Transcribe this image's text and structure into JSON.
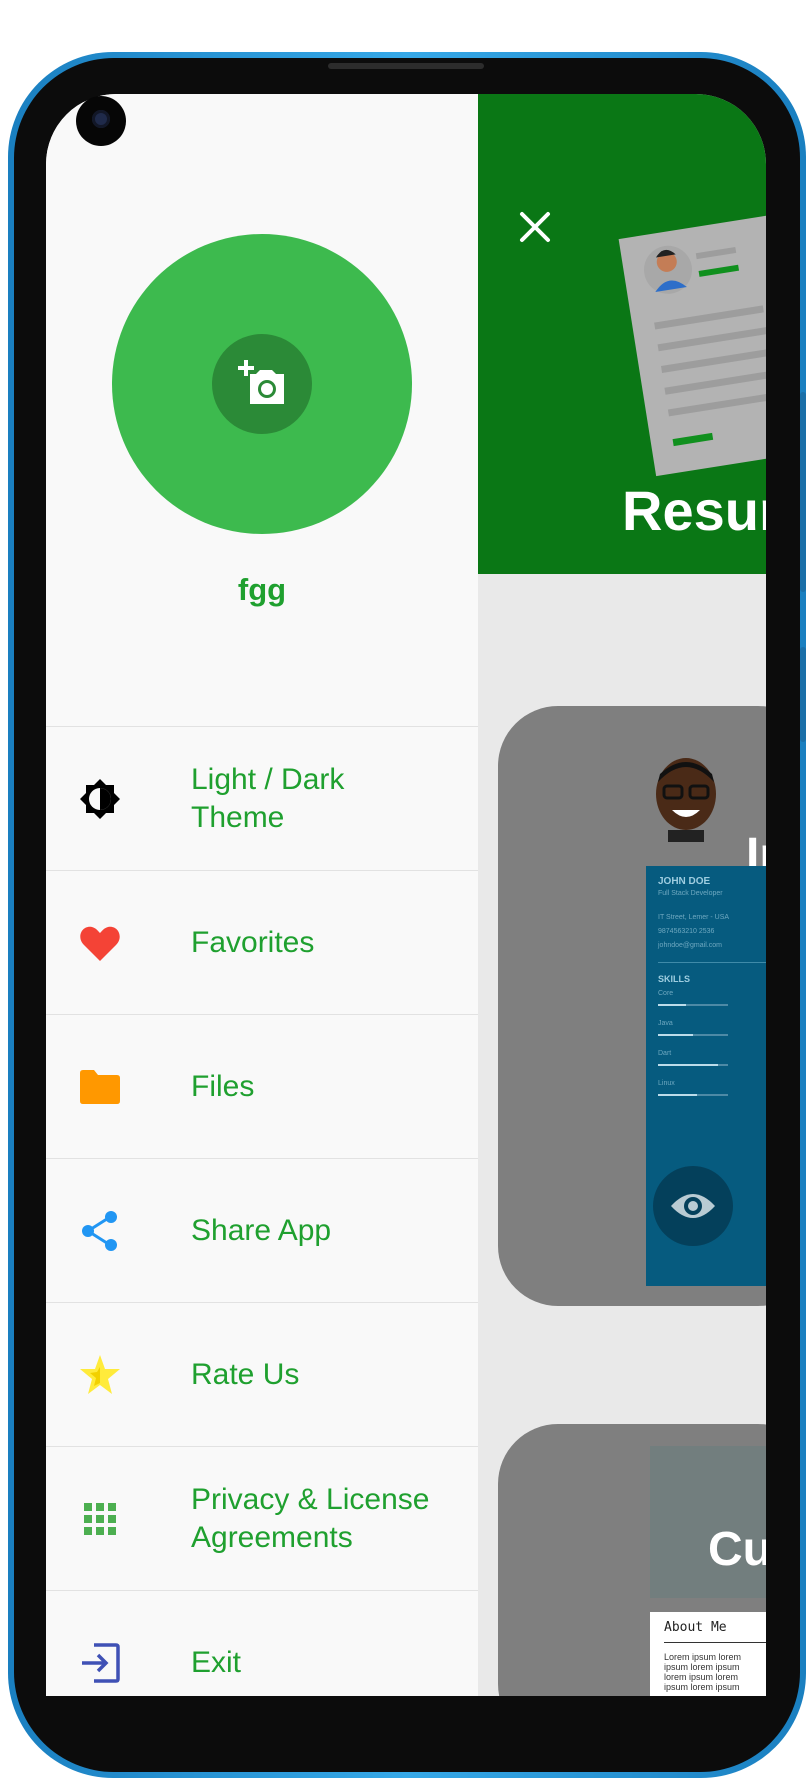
{
  "drawer": {
    "user_name": "fgg",
    "avatar_icon": "add-a-photo-icon",
    "menu": [
      {
        "label": "Light / Dark Theme",
        "icon": "brightness-icon",
        "color": "#000000"
      },
      {
        "label": "Favorites",
        "icon": "heart-icon",
        "color": "#f44336"
      },
      {
        "label": "Files",
        "icon": "folder-icon",
        "color": "#ff9800"
      },
      {
        "label": "Share App",
        "icon": "share-icon",
        "color": "#2196f3"
      },
      {
        "label": "Rate Us",
        "icon": "star-icon",
        "color": "#ffeb3b"
      },
      {
        "label": "Privacy & License Agreements",
        "icon": "apps-grid-icon",
        "color": "#4caf50"
      },
      {
        "label": "Exit",
        "icon": "exit-icon",
        "color": "#3f51b5"
      }
    ]
  },
  "header": {
    "title": "Resume",
    "close_icon": "close-icon"
  },
  "cards": [
    {
      "title": "In",
      "template": {
        "name": "JOHN DOE",
        "subtitle": "Full Stack Developer",
        "contact": [
          "IT Street, Lemer - USA",
          "9874563210 2536",
          "johndoe@gmail.com"
        ],
        "skills_heading": "SKILLS",
        "skills": [
          {
            "name": "Core",
            "level": 0.4
          },
          {
            "name": "Java",
            "level": 0.5
          },
          {
            "name": "Dart",
            "level": 0.85
          },
          {
            "name": "Linux",
            "level": 0.55
          }
        ]
      },
      "preview_icon": "eye-icon"
    },
    {
      "title": "Cu",
      "about_heading": "About Me",
      "about_text": "Lorem ipsum lorem ipsum lorem ipsum lorem ipsum lorem ipsum lorem ipsum"
    }
  ],
  "colors": {
    "accent": "#1fa02f",
    "header": "#0a7715",
    "avatar": "#3dba4e",
    "card": "#7f7f7f",
    "template": "#065b7f"
  }
}
